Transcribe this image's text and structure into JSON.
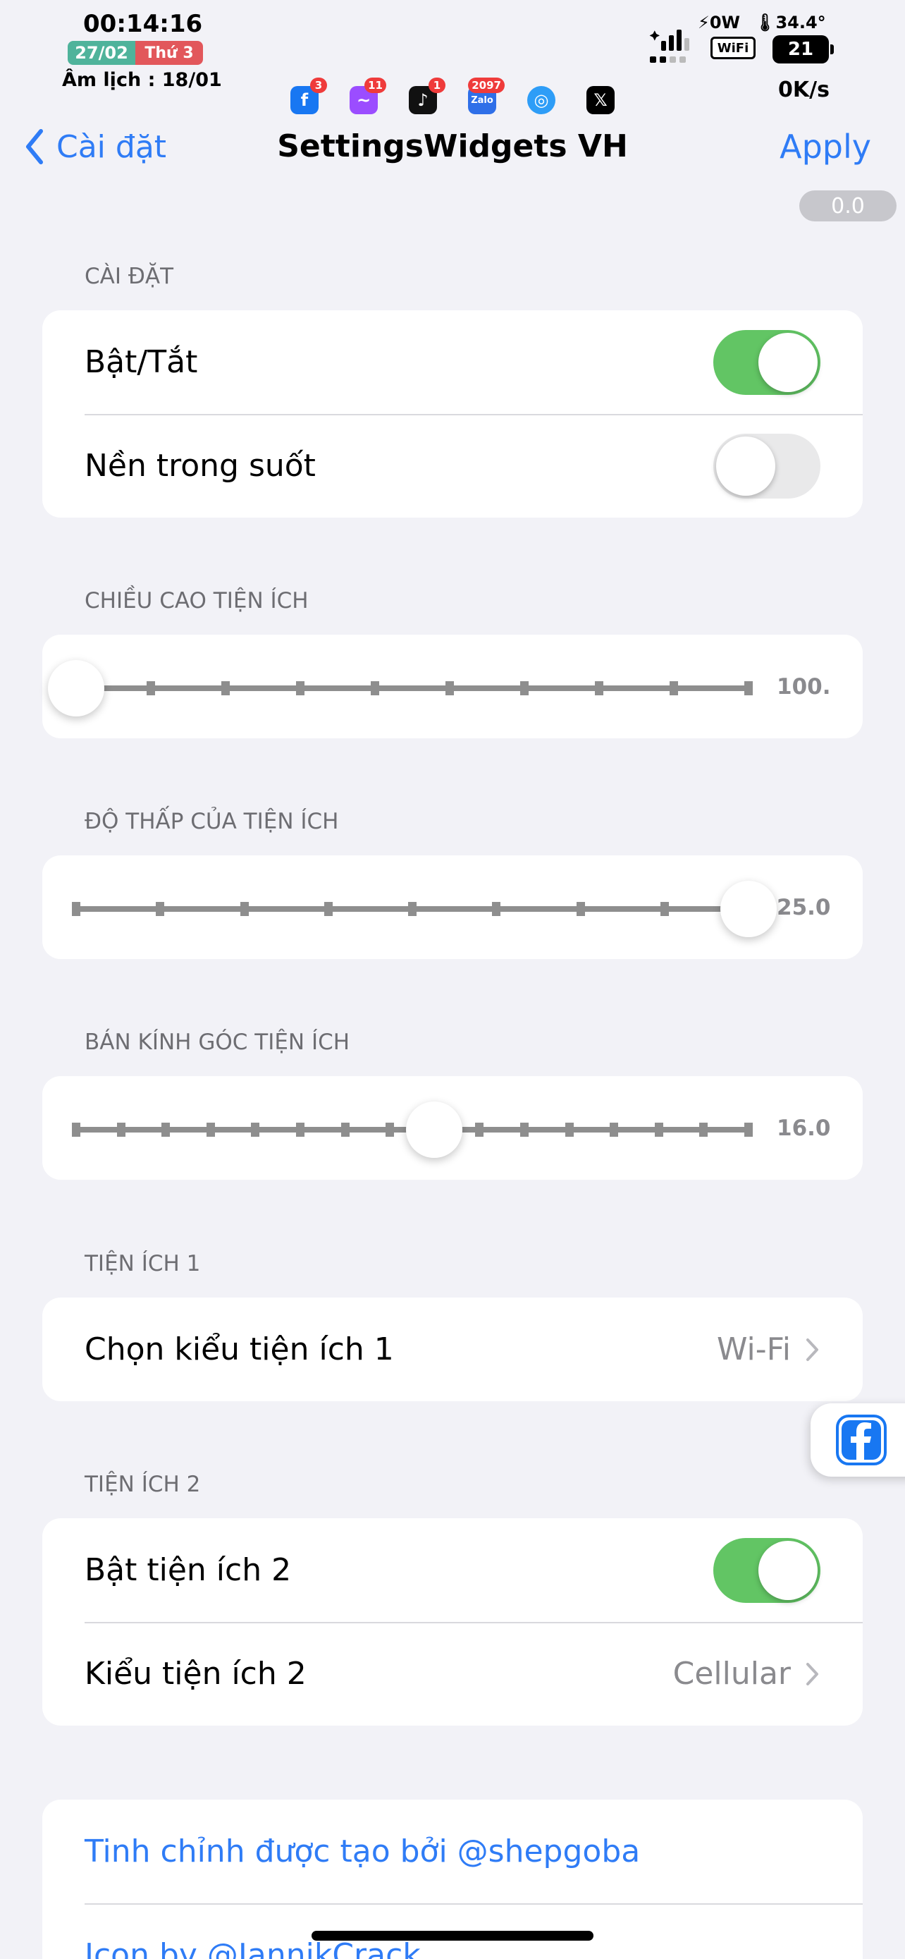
{
  "status_bar": {
    "time": "00:14:16",
    "date": "27/02",
    "weekday": "Thứ 3",
    "lunar": "Âm lịch : 18/01",
    "power": "⚡0W",
    "temperature": "🌡34.4°",
    "wifi_label": "WiFi",
    "battery": "21",
    "net_speed": "0K/s"
  },
  "notification_icons": [
    {
      "name": "facebook",
      "badge": "3",
      "color": "#1877f2",
      "glyph": "f"
    },
    {
      "name": "messenger",
      "badge": "11",
      "color": "#9b4dff",
      "glyph": "~"
    },
    {
      "name": "tiktok",
      "badge": "1",
      "color": "#111111",
      "glyph": "♪"
    },
    {
      "name": "zalo",
      "badge": "2097",
      "color": "#2f6fe8",
      "glyph": "Zalo"
    },
    {
      "name": "safari",
      "badge": "",
      "color": "#2e9df7",
      "glyph": "◎"
    },
    {
      "name": "x",
      "badge": "",
      "color": "#000000",
      "glyph": "𝕏"
    }
  ],
  "nav": {
    "back_label": "Cài đặt",
    "title": "SettingsWidgets VH",
    "apply_label": "Apply",
    "version": "0.0"
  },
  "sections": {
    "settings": {
      "header": "CÀI ĐẶT",
      "rows": [
        {
          "label": "Bật/Tắt",
          "toggle": "on"
        },
        {
          "label": "Nền trong suốt",
          "toggle": "off"
        }
      ]
    },
    "height": {
      "header": "CHIỀU CAO TIỆN ÍCH",
      "value_text": "100.",
      "position": 0.0,
      "ticks": 10
    },
    "offset": {
      "header": "ĐỘ THẤP CỦA TIỆN ÍCH",
      "value_text": "25.0",
      "position": 1.0,
      "ticks": 9
    },
    "radius": {
      "header": "BÁN KÍNH GÓC TIỆN ÍCH",
      "value_text": "16.0",
      "position": 0.533,
      "ticks": 16
    },
    "widget1": {
      "header": "TIỆN ÍCH 1",
      "row_label": "Chọn kiểu tiện ích 1",
      "row_value": "Wi-Fi"
    },
    "widget2": {
      "header": "TIỆN ÍCH 2",
      "toggle_label": "Bật tiện ích 2",
      "toggle": "on",
      "row_label": "Kiểu tiện ích 2",
      "row_value": "Cellular"
    },
    "credits": {
      "line1": "Tinh chỉnh được tạo bởi @shepgoba",
      "line2": "Icon by @JannikCrack"
    }
  },
  "colors": {
    "accent": "#2f7cf6",
    "toggle_on": "#62c564",
    "background": "#f2f2f7"
  }
}
